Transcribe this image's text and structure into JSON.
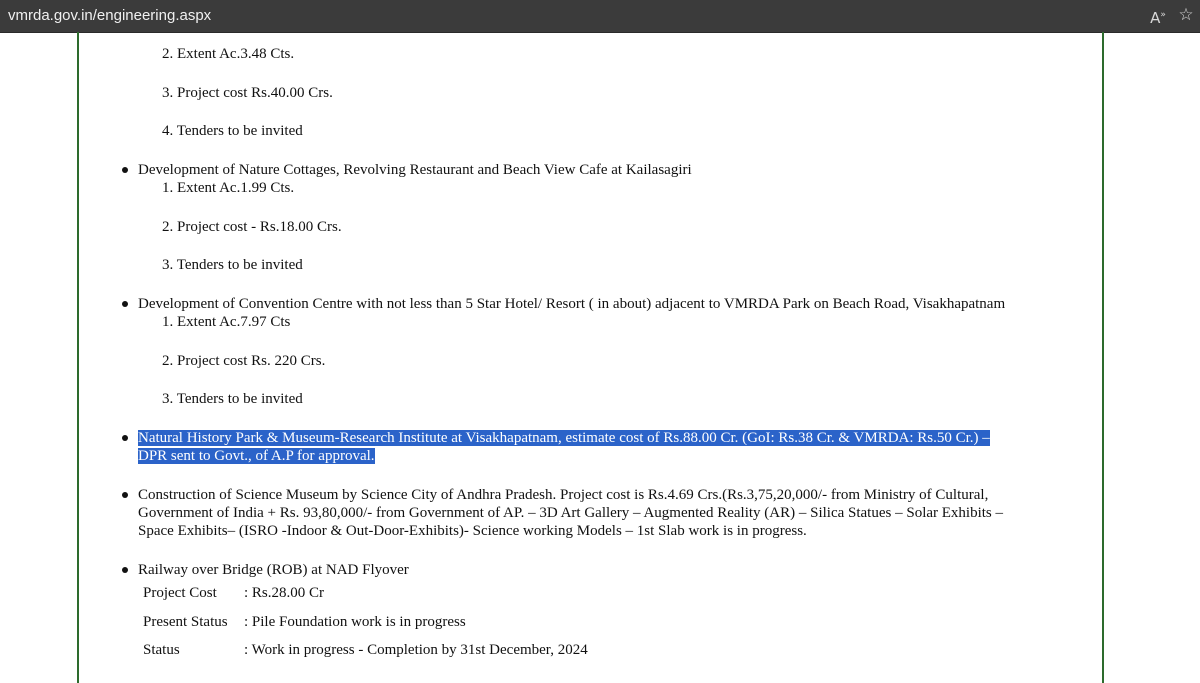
{
  "browser": {
    "url": "vmrda.gov.in/engineering.aspx",
    "read_aloud_icon": "read-aloud-icon",
    "favorite_icon": "favorite-star-icon"
  },
  "items": {
    "prev_list": [
      "2. Extent Ac.3.48 Cts.",
      "3. Project cost Rs.40.00 Crs.",
      "4. Tenders to be invited"
    ],
    "kailasagiri": {
      "title": "Development of Nature Cottages, Revolving Restaurant and Beach View Cafe at Kailasagiri",
      "details": [
        "1. Extent Ac.1.99 Cts.",
        "2. Project cost - Rs.18.00 Crs.",
        "3. Tenders to be invited"
      ]
    },
    "convention": {
      "title": "Development of Convention Centre with not less than 5 Star Hotel/ Resort ( in about) adjacent to VMRDA Park on Beach Road, Visakhapatnam",
      "details": [
        "1. Extent Ac.7.97 Cts",
        "2. Project cost Rs. 220 Crs.",
        "3. Tenders to be invited"
      ]
    },
    "natural_history": {
      "line1": "Natural History Park & Museum-Research Institute at Visakhapatnam, estimate cost of Rs.88.00 Cr. (GoI: Rs.38 Cr. & VMRDA: Rs.50 Cr.) –",
      "line2": "DPR sent to Govt., of A.P for approval."
    },
    "science_museum": {
      "line1": "Construction of Science Museum by Science City of Andhra Pradesh. Project cost is Rs.4.69 Crs.(Rs.3,75,20,000/- from Ministry of Cultural,",
      "line2": "Government of India + Rs. 93,80,000/- from Government of AP. – 3D Art Gallery – Augmented Reality (AR) – Silica Statues – Solar Exhibits –",
      "line3": "Space Exhibits– (ISRO -Indoor & Out-Door-Exhibits)- Science working Models – 1st Slab work is in progress."
    },
    "rob": {
      "title": "Railway over Bridge (ROB) at NAD Flyover",
      "rows": [
        {
          "label": "Project Cost",
          "value": ": Rs.28.00 Cr"
        },
        {
          "label": "Present Status",
          "value": ": Pile Foundation work is in progress"
        },
        {
          "label": "Status",
          "value": ": Work in progress - Completion by 31st December, 2024"
        }
      ]
    }
  }
}
